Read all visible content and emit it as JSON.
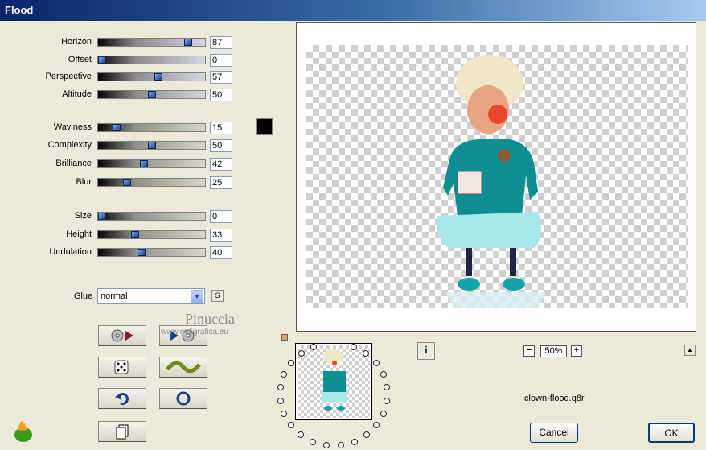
{
  "window": {
    "title": "Flood"
  },
  "sliders": [
    {
      "label": "Horizon",
      "value": "87",
      "fraction": 0.87
    },
    {
      "label": "Offset",
      "value": "0",
      "fraction": 0.0
    },
    {
      "label": "Perspective",
      "value": "57",
      "fraction": 0.57
    },
    {
      "label": "Altitude",
      "value": "50",
      "fraction": 0.5
    },
    {
      "label": "Waviness",
      "value": "15",
      "fraction": 0.15
    },
    {
      "label": "Complexity",
      "value": "50",
      "fraction": 0.5
    },
    {
      "label": "Brilliance",
      "value": "42",
      "fraction": 0.42
    },
    {
      "label": "Blur",
      "value": "25",
      "fraction": 0.25
    },
    {
      "label": "Size",
      "value": "0",
      "fraction": 0.0
    },
    {
      "label": "Height",
      "value": "33",
      "fraction": 0.33
    },
    {
      "label": "Undulation",
      "value": "40",
      "fraction": 0.4
    }
  ],
  "color_swatch": "#000000",
  "glue": {
    "label": "Glue",
    "value": "normal",
    "s_button": "S"
  },
  "watermark": {
    "name": "Pinuccia",
    "url": "www.mdigrafica.eu"
  },
  "zoom": {
    "value": "50%",
    "minus": "−",
    "plus": "+"
  },
  "info_button": "i",
  "top_button": "▲",
  "preset_file": "clown-flood.q8r",
  "buttons": {
    "cancel": "Cancel",
    "ok": "OK"
  },
  "tool_icons": [
    "randomize-preview-icon",
    "play-preview-icon",
    "dice-icon",
    "wave-icon",
    "undo-icon",
    "reset-icon",
    "copy-icon"
  ]
}
